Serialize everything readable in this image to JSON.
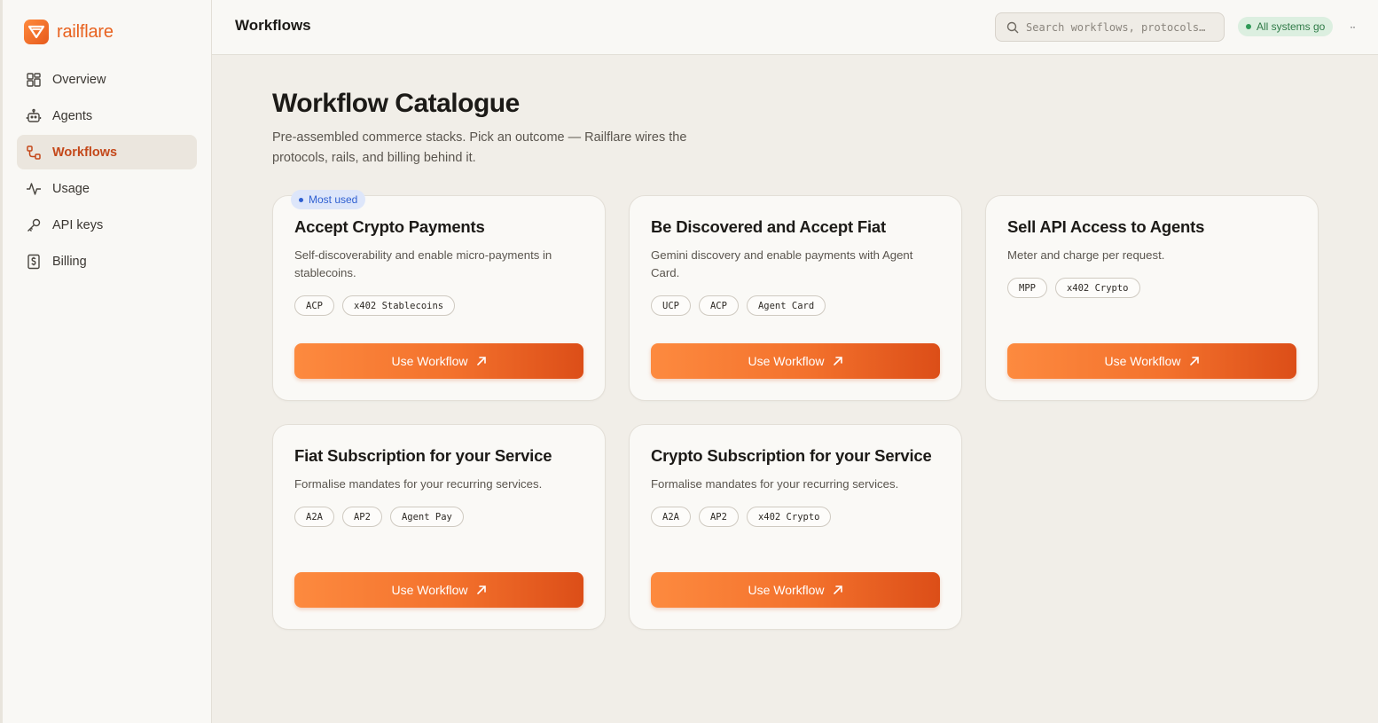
{
  "brand": {
    "name": "railflare",
    "accent": "#e8621f"
  },
  "sidebar": {
    "items": [
      {
        "label": "Overview",
        "icon": "grid-icon",
        "active": false
      },
      {
        "label": "Agents",
        "icon": "robot-icon",
        "active": false
      },
      {
        "label": "Workflows",
        "icon": "workflow-icon",
        "active": true
      },
      {
        "label": "Usage",
        "icon": "activity-icon",
        "active": false
      },
      {
        "label": "API keys",
        "icon": "key-icon",
        "active": false
      },
      {
        "label": "Billing",
        "icon": "billing-icon",
        "active": false
      }
    ]
  },
  "header": {
    "title": "Workflows",
    "search_placeholder": "Search workflows, protocols…",
    "status_label": "All systems go",
    "status_color": "#2f9a57"
  },
  "main": {
    "title": "Workflow Catalogue",
    "subtitle": "Pre-assembled commerce stacks. Pick an outcome — Railflare wires the protocols, rails, and billing behind it.",
    "cards": [
      {
        "badge": "Most used",
        "title": "Accept Crypto Payments",
        "description": "Self-discoverability and enable micro-payments in stablecoins.",
        "tags": [
          "ACP",
          "x402 Stablecoins"
        ],
        "cta": "Use Workflow"
      },
      {
        "title": "Be Discovered and Accept Fiat",
        "description": "Gemini discovery and enable payments with Agent Card.",
        "tags": [
          "UCP",
          "ACP",
          "Agent Card"
        ],
        "cta": "Use Workflow"
      },
      {
        "title": "Sell API Access to Agents",
        "description": "Meter and charge per request.",
        "tags": [
          "MPP",
          "x402 Crypto"
        ],
        "cta": "Use Workflow"
      },
      {
        "title": "Fiat Subscription for your Service",
        "description": "Formalise mandates for your recurring services.",
        "tags": [
          "A2A",
          "AP2",
          "Agent Pay"
        ],
        "cta": "Use Workflow"
      },
      {
        "title": "Crypto Subscription for your Service",
        "description": "Formalise mandates for your recurring services.",
        "tags": [
          "A2A",
          "AP2",
          "x402 Crypto"
        ],
        "cta": "Use Workflow"
      }
    ]
  }
}
